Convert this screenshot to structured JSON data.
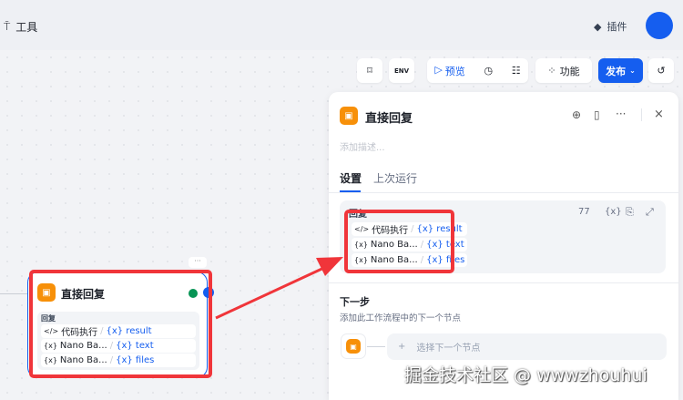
{
  "topbar": {
    "tools_label": "工具",
    "plugins_label": "插件"
  },
  "toolbar": {
    "env_label": "ENV",
    "preview_label": "预览",
    "features_label": "功能",
    "publish_label": "发布"
  },
  "node": {
    "title": "直接回复",
    "section_label": "回复",
    "vars": [
      {
        "source_icon": "</>",
        "source": "代码执行",
        "var": "{x} result"
      },
      {
        "source_icon": "{x}",
        "source": "Nano Ba...",
        "var": "{x} text"
      },
      {
        "source_icon": "{x}",
        "source": "Nano Ba...",
        "var": "{x} files"
      }
    ]
  },
  "panel": {
    "title": "直接回复",
    "description_placeholder": "添加描述...",
    "tabs": [
      {
        "label": "设置",
        "active": true
      },
      {
        "label": "上次运行",
        "active": false
      }
    ],
    "reply_label": "回复",
    "char_count": "77",
    "var_button": "{x}",
    "vars": [
      {
        "source_icon": "</>",
        "source": "代码执行",
        "var": "{x} result"
      },
      {
        "source_icon": "{x}",
        "source": "Nano Ba...",
        "var": "{x} text"
      },
      {
        "source_icon": "{x}",
        "source": "Nano Ba...",
        "var": "{x} files"
      }
    ],
    "next_step_title": "下一步",
    "next_step_desc": "添加此工作流程中的下一个节点",
    "select_next_label": "选择下一个节点"
  },
  "watermark": "掘金技术社区 @ wwwzhouhui",
  "colors": {
    "accent": "#155eef",
    "node_icon": "#f79009",
    "highlight": "#f0353a"
  }
}
